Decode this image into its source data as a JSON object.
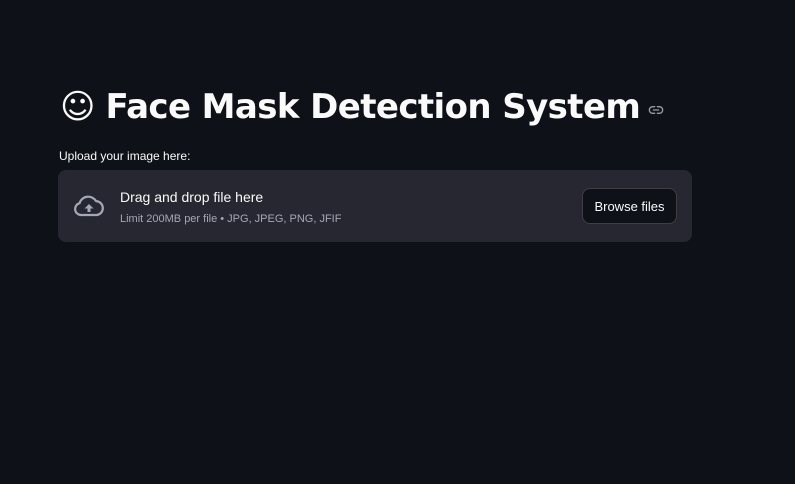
{
  "header": {
    "emoji": "☺",
    "title": "Face Mask Detection System",
    "anchor_icon": "link-icon"
  },
  "uploader": {
    "label": "Upload your image here:",
    "icon": "cloud-upload-icon",
    "drop_text": "Drag and drop file here",
    "limit_text": "Limit 200MB per file • JPG, JPEG, PNG, JFIF",
    "browse_label": "Browse files"
  },
  "colors": {
    "background": "#0e1117",
    "dropzone": "#262730",
    "text": "#fafafa",
    "muted_text": "#a3a8b8"
  }
}
